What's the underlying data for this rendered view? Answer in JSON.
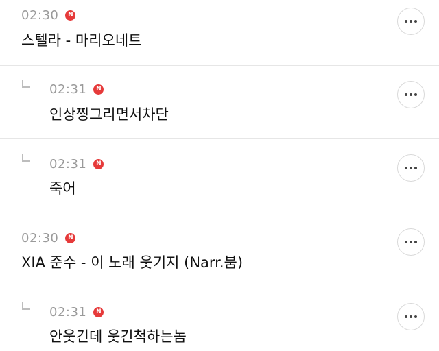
{
  "comments": [
    {
      "time": "02:30",
      "badge": "N",
      "text": "스텔라 - 마리오네트",
      "is_reply": false
    },
    {
      "time": "02:31",
      "badge": "N",
      "text": "인상찡그리면서차단",
      "is_reply": true
    },
    {
      "time": "02:31",
      "badge": "N",
      "text": "죽어",
      "is_reply": true
    },
    {
      "time": "02:30",
      "badge": "N",
      "text": "XIA 준수 - 이 노래 웃기지 (Narr.붐)",
      "is_reply": false
    },
    {
      "time": "02:31",
      "badge": "N",
      "text": "안웃긴데 웃긴척하는놈",
      "is_reply": true
    }
  ],
  "more_icon": "more-horizontal-icon",
  "colors": {
    "badge": "#e63a3a",
    "time": "#9a9a9a",
    "text": "#111111",
    "divider": "#e6e6e6"
  }
}
